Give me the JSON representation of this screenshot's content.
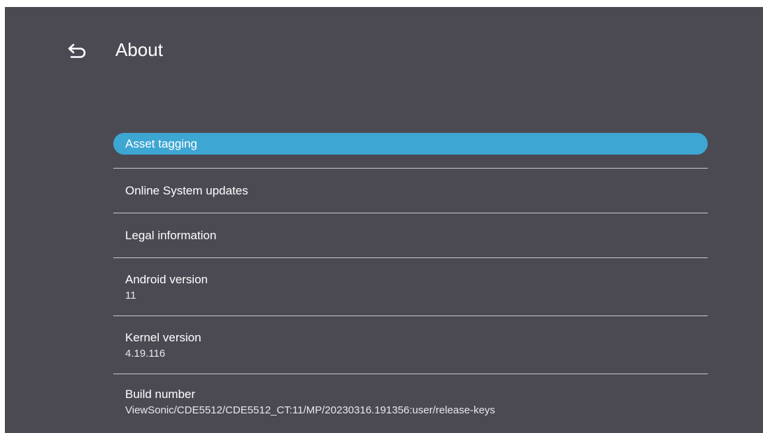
{
  "header": {
    "back_icon": "back-arrow-icon",
    "title": "About"
  },
  "menu": {
    "items": [
      {
        "label": "Asset tagging",
        "selected": true
      },
      {
        "label": "Online System updates"
      },
      {
        "label": "Legal information"
      },
      {
        "label": "Android version",
        "value": "11"
      },
      {
        "label": "Kernel version",
        "value": "4.19.116"
      },
      {
        "label": "Build number",
        "value": "ViewSonic/CDE5512/CDE5512_CT:11/MP/20230316.191356:user/release-keys"
      }
    ]
  },
  "colors": {
    "background": "#4b4a53",
    "highlight": "#3ea6d2",
    "divider": "#c9c9ce",
    "text": "#ffffff"
  }
}
